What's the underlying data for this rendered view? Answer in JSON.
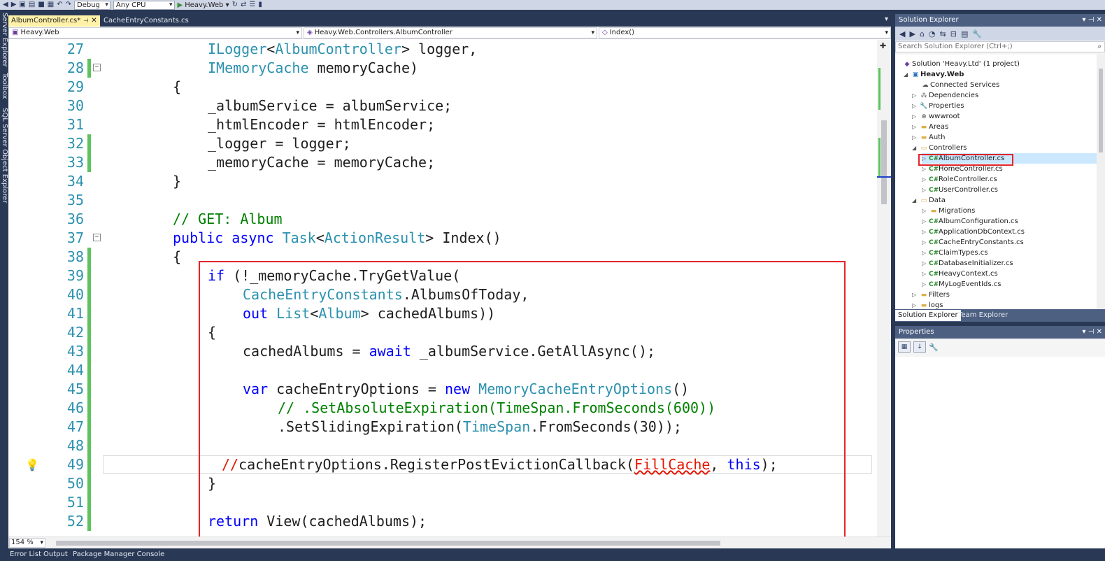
{
  "toolbar": {
    "config": "Debug",
    "platform": "Any CPU",
    "run_target": "Heavy.Web"
  },
  "left_strip": {
    "tabs": [
      "Server Explorer",
      "Toolbox",
      "SQL Server Object Explorer"
    ]
  },
  "editor": {
    "tabs": [
      {
        "label": "AlbumController.cs*",
        "active": true
      },
      {
        "label": "CacheEntryConstants.cs",
        "active": false
      }
    ],
    "nav": {
      "project": "Heavy.Web",
      "class": "Heavy.Web.Controllers.AlbumController",
      "member": "Index()"
    },
    "zoom": "154 %",
    "line_numbers": [
      "27",
      "28",
      "29",
      "30",
      "31",
      "32",
      "33",
      "34",
      "35",
      "36",
      "37",
      "38",
      "39",
      "40",
      "41",
      "42",
      "43",
      "44",
      "45",
      "46",
      "47",
      "48",
      "49",
      "50",
      "51",
      "52"
    ]
  },
  "code": {
    "l27": [
      "ILogger",
      "<",
      "AlbumController",
      "> logger,"
    ],
    "l28": [
      "IMemoryCache",
      " memoryCache)"
    ],
    "l29": "{",
    "l30": "_albumService = albumService;",
    "l31": "_htmlEncoder = htmlEncoder;",
    "l32": "_logger = logger;",
    "l33": "_memoryCache = memoryCache;",
    "l34": "}",
    "l36": "// GET: Album",
    "l37": [
      "public",
      " ",
      "async",
      " ",
      "Task",
      "<",
      "ActionResult",
      "> Index()"
    ],
    "l38": "{",
    "l39": [
      "if",
      " (!_memoryCache.TryGetValue("
    ],
    "l40": [
      "CacheEntryConstants",
      ".AlbumsOfToday,"
    ],
    "l41": [
      "out",
      " ",
      "List",
      "<",
      "Album",
      "> cachedAlbums))"
    ],
    "l42": "{",
    "l43": [
      "cachedAlbums = ",
      "await",
      " _albumService.GetAllAsync();"
    ],
    "l45": [
      "var",
      " cacheEntryOptions = ",
      "new",
      " ",
      "MemoryCacheEntryOptions",
      "()"
    ],
    "l46": "// .SetAbsoluteExpiration(TimeSpan.FromSeconds(600))",
    "l47": [
      ".SetSlidingExpiration(",
      "TimeSpan",
      ".FromSeconds(30));"
    ],
    "l49": [
      "//",
      "cacheEntryOptions.RegisterPostEvictionCallback(",
      "FillCache",
      ", ",
      "this",
      ");"
    ],
    "l50": "}",
    "l52": [
      "return",
      " ",
      "View",
      "(cachedAlbums);"
    ]
  },
  "solution_explorer": {
    "title": "Solution Explorer",
    "search_placeholder": "Search Solution Explorer (Ctrl+;)",
    "items": [
      {
        "label": "Solution 'Heavy.Ltd' (1 project)"
      },
      {
        "label": "Heavy.Web"
      },
      {
        "label": "Connected Services"
      },
      {
        "label": "Dependencies"
      },
      {
        "label": "Properties"
      },
      {
        "label": "wwwroot"
      },
      {
        "label": "Areas"
      },
      {
        "label": "Auth"
      },
      {
        "label": "Controllers"
      },
      {
        "label": "AlbumController.cs"
      },
      {
        "label": "HomeController.cs"
      },
      {
        "label": "RoleController.cs"
      },
      {
        "label": "UserController.cs"
      },
      {
        "label": "Data"
      },
      {
        "label": "Migrations"
      },
      {
        "label": "AlbumConfiguration.cs"
      },
      {
        "label": "ApplicationDbContext.cs"
      },
      {
        "label": "CacheEntryConstants.cs"
      },
      {
        "label": "ClaimTypes.cs"
      },
      {
        "label": "DatabaseInitializer.cs"
      },
      {
        "label": "HeavyContext.cs"
      },
      {
        "label": "MyLogEventIds.cs"
      },
      {
        "label": "Filters"
      },
      {
        "label": "logs"
      }
    ],
    "tabs": [
      "Solution Explorer",
      "Team Explorer"
    ]
  },
  "properties": {
    "title": "Properties"
  },
  "bottom_tabs": [
    "Error List",
    "Output",
    "Package Manager Console"
  ],
  "colors": {
    "keyword": "#0000ff",
    "type": "#2b91af",
    "comment": "#008000",
    "error": "#e51400",
    "highlight_box": "#e3242b",
    "chrome": "#293955"
  }
}
